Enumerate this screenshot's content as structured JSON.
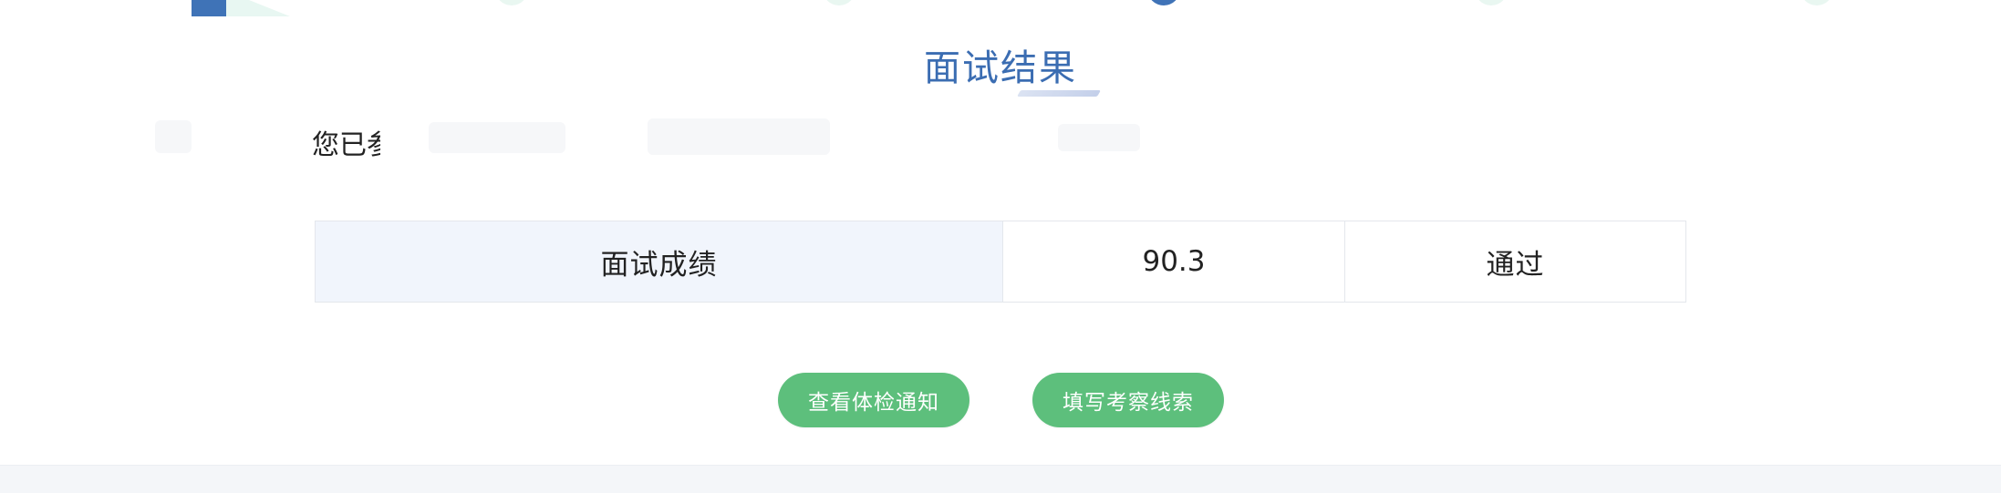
{
  "title": "面试结果",
  "notice": {
    "text": "您已参"
  },
  "results_table": {
    "label": "面试成绩",
    "score": "90.3",
    "status": "通过"
  },
  "actions": {
    "view_medical_notice": "查看体检通知",
    "fill_inspection_clues": "填写考察线索"
  },
  "colors": {
    "title": "#3b6db2",
    "button_bg": "#5dbf7c",
    "table_label_bg": "#f1f5fc",
    "step_active": "#3f73b7",
    "step_inactive": "#e9f7f1"
  },
  "icons": {
    "logo": "logo-mark-icon",
    "steps": [
      "step-dot-icon",
      "step-dot-icon",
      "step-dot-icon",
      "step-dot-icon",
      "step-dot-icon"
    ]
  }
}
